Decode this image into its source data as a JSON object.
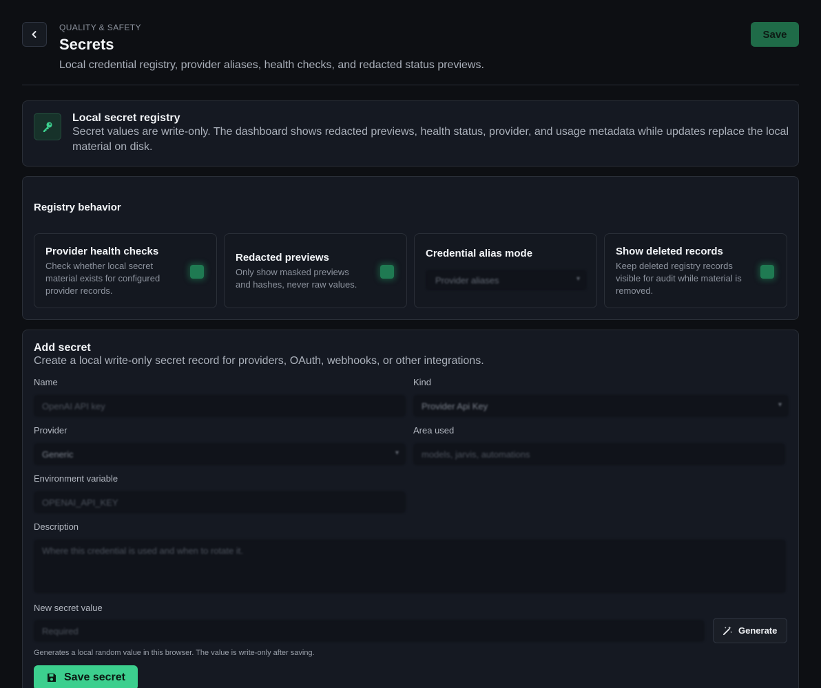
{
  "header": {
    "eyebrow": "QUALITY & SAFETY",
    "title": "Secrets",
    "subtitle": "Local credential registry, provider aliases, health checks, and redacted status previews.",
    "save_label": "Save"
  },
  "info": {
    "icon": "key-icon",
    "title": "Local secret registry",
    "text": "Secret values are write-only. The dashboard shows redacted previews, health status, provider, and usage metadata while updates replace the local material on disk."
  },
  "registry": {
    "title": "Registry behavior",
    "options": [
      {
        "title": "Provider health checks",
        "description": "Check whether local secret material exists for configured provider records.",
        "enabled": true
      },
      {
        "title": "Redacted previews",
        "description": "Only show masked previews and hashes, never raw values.",
        "enabled": true
      },
      {
        "title": "Credential alias mode",
        "selected": "Provider aliases"
      },
      {
        "title": "Show deleted records",
        "description": "Keep deleted registry records visible for audit while material is removed.",
        "enabled": true
      }
    ]
  },
  "add_secret": {
    "title": "Add secret",
    "subtitle": "Create a local write-only secret record for providers, OAuth, webhooks, or other integrations.",
    "name": {
      "label": "Name",
      "placeholder": "OpenAI API key"
    },
    "kind": {
      "label": "Kind",
      "value": "Provider Api Key"
    },
    "provider": {
      "label": "Provider",
      "value": "Generic"
    },
    "area": {
      "label": "Area used",
      "placeholder": "models, jarvis, automations"
    },
    "env": {
      "label": "Environment variable",
      "placeholder": "OPENAI_API_KEY"
    },
    "description": {
      "label": "Description",
      "placeholder": "Where this credential is used and when to rotate it."
    },
    "secret": {
      "label": "New secret value",
      "placeholder": "Required"
    },
    "generate_label": "Generate",
    "helper": "Generates a local random value in this browser. The value is write-only after saving.",
    "save_label": "Save secret"
  }
}
